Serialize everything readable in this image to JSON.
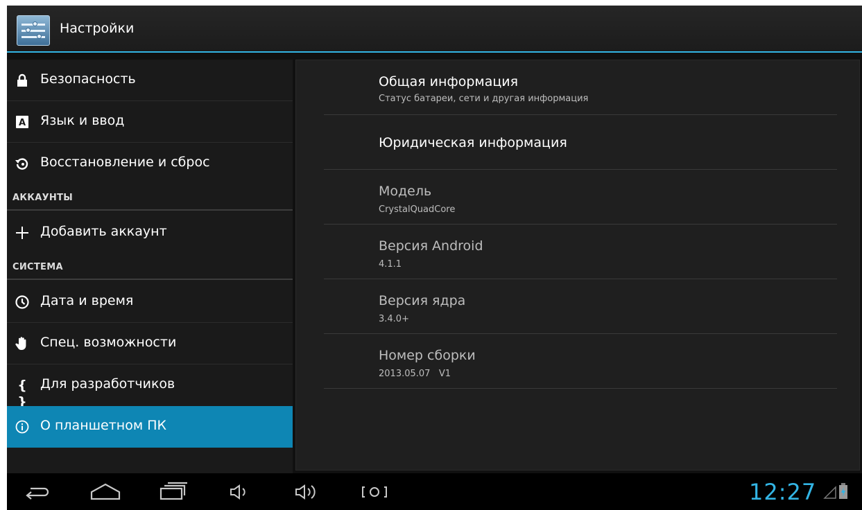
{
  "action_bar": {
    "title": "Настройки",
    "icon": "settings-sliders-icon"
  },
  "sidebar": {
    "items": [
      {
        "label": "Безопасность",
        "icon": "lock-icon"
      },
      {
        "label": "Язык и ввод",
        "icon": "keyboard-a-icon"
      },
      {
        "label": "Восстановление и сброс",
        "icon": "restore-icon"
      },
      {
        "section": "АККАУНТЫ"
      },
      {
        "label": "Добавить аккаунт",
        "icon": "plus-icon"
      },
      {
        "section": "СИСТЕМА"
      },
      {
        "label": "Дата и время",
        "icon": "clock-icon"
      },
      {
        "label": "Спец. возможности",
        "icon": "hand-icon"
      },
      {
        "label": "Для разработчиков",
        "icon": "braces-icon"
      },
      {
        "label": "О планшетном ПК",
        "icon": "info-icon",
        "selected": true
      }
    ]
  },
  "detail": {
    "rows": [
      {
        "title": "Общая информация",
        "subtitle": "Статус батареи, сети и другая информация"
      },
      {
        "title": "Юридическая информация"
      },
      {
        "title": "Модель",
        "subtitle": "CrystalQuadCore"
      },
      {
        "title": "Версия Android",
        "subtitle": "4.1.1"
      },
      {
        "title": "Версия ядра",
        "subtitle": "3.4.0+"
      },
      {
        "title": "Номер сборки",
        "subtitle": "2013.05.07   V1"
      }
    ]
  },
  "nav_bar": {
    "buttons": [
      "back-icon",
      "home-icon",
      "recent-apps-icon",
      "volume-down-icon",
      "volume-up-icon",
      "screenshot-icon"
    ],
    "clock": "12:27",
    "status_icons": [
      "signal-icon",
      "battery-charging-icon"
    ],
    "accent_color": "#33b5e5"
  },
  "colors": {
    "accent": "#33b5e5",
    "selected": "#0e86b4"
  }
}
